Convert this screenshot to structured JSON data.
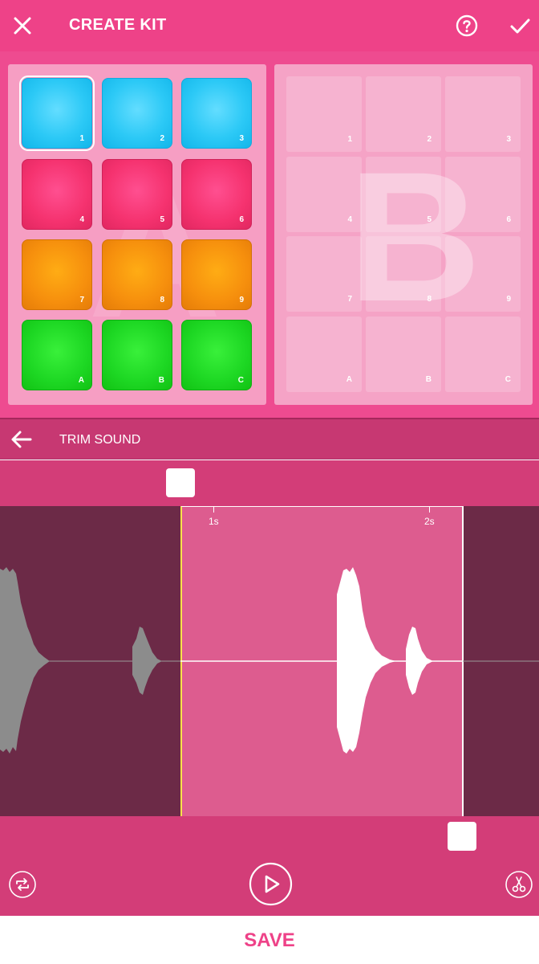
{
  "topbar": {
    "title": "CREATE KIT",
    "icons": {
      "close": "close-icon",
      "help": "help-icon",
      "confirm": "check-icon"
    }
  },
  "bank_a": {
    "letter": "A",
    "pads": [
      {
        "label": "1",
        "color": "blue"
      },
      {
        "label": "2",
        "color": "blue"
      },
      {
        "label": "3",
        "color": "blue"
      },
      {
        "label": "4",
        "color": "pink"
      },
      {
        "label": "5",
        "color": "pink"
      },
      {
        "label": "6",
        "color": "pink"
      },
      {
        "label": "7",
        "color": "orange"
      },
      {
        "label": "8",
        "color": "orange"
      },
      {
        "label": "9",
        "color": "orange"
      },
      {
        "label": "A",
        "color": "green"
      },
      {
        "label": "B",
        "color": "green"
      },
      {
        "label": "C",
        "color": "green"
      }
    ]
  },
  "bank_b": {
    "letter": "B",
    "pads": [
      "1",
      "2",
      "3",
      "4",
      "5",
      "6",
      "7",
      "8",
      "9",
      "A",
      "B",
      "C"
    ]
  },
  "trim": {
    "title": "TRIM SOUND",
    "timeline": [
      "1s",
      "2s"
    ],
    "icons": {
      "back": "arrow-left-icon",
      "loop": "loop-icon",
      "play": "play-icon",
      "cut": "scissors-icon"
    }
  },
  "save_label": "SAVE",
  "colors": {
    "primary": "#ee4288",
    "pad_blue": "#2cc9f6",
    "pad_pink": "#f5326f",
    "pad_orange": "#f68f0d",
    "pad_green": "#1dd723",
    "waveform_bg": "#6c2a47",
    "selection": "#dd5c8f"
  }
}
